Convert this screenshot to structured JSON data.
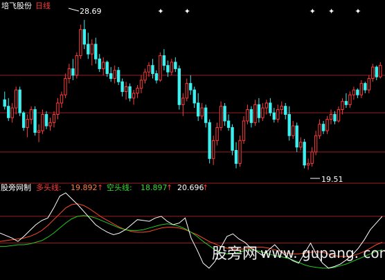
{
  "header": {
    "stock_name": "培飞股份",
    "period": "日线"
  },
  "price_panel": {
    "high_label": "28.69",
    "low_label": "19.51",
    "marker_symbol": "✦"
  },
  "indicator_panel": {
    "name": "股旁网制",
    "items": [
      {
        "label": "多头线:",
        "value": "19.892",
        "arrow": "↑"
      },
      {
        "label": "空头线:",
        "value": "18.897",
        "arrow": "↑"
      },
      {
        "label": "",
        "value": "20.696",
        "arrow": "↑"
      }
    ]
  },
  "watermark": {
    "cn": "股旁网",
    "url": "www. gupang. com"
  },
  "colors": {
    "up": "#ff3b3b",
    "down": "#3cf0f0",
    "grid": "#9b1e1e",
    "white": "#ffffff",
    "long_line": "#ff4a2a",
    "short_line": "#22cc22",
    "value_orange": "#ff8040",
    "value_green": "#33dd33"
  },
  "chart_data": [
    {
      "type": "candlestick",
      "title": "培飞股份 日线",
      "ylim": [
        18.9,
        29.4
      ],
      "high": 28.69,
      "low": 19.51,
      "candles_ohlc": [
        [
          23.8,
          24.3,
          23.2,
          23.4
        ],
        [
          23.4,
          23.9,
          22.5,
          22.7
        ],
        [
          22.7,
          23.6,
          22.4,
          23.3
        ],
        [
          23.3,
          24.6,
          22.9,
          24.4
        ],
        [
          24.4,
          24.6,
          22.8,
          23.0
        ],
        [
          23.0,
          23.1,
          21.9,
          22.1
        ],
        [
          22.1,
          22.9,
          21.5,
          22.6
        ],
        [
          22.6,
          23.4,
          22.3,
          23.2
        ],
        [
          23.2,
          23.4,
          21.6,
          21.8
        ],
        [
          21.8,
          22.3,
          21.2,
          21.9
        ],
        [
          21.9,
          23.2,
          21.7,
          22.9
        ],
        [
          22.9,
          23.1,
          22.0,
          22.2
        ],
        [
          22.2,
          22.7,
          21.9,
          22.4
        ],
        [
          22.4,
          23.1,
          22.1,
          22.9
        ],
        [
          22.9,
          23.9,
          22.6,
          23.6
        ],
        [
          23.6,
          24.3,
          23.3,
          24.1
        ],
        [
          24.1,
          25.4,
          23.9,
          25.1
        ],
        [
          25.1,
          26.0,
          24.8,
          25.7
        ],
        [
          25.7,
          26.3,
          25.0,
          25.3
        ],
        [
          25.3,
          26.7,
          25.1,
          26.5
        ],
        [
          26.5,
          28.4,
          26.3,
          28.1
        ],
        [
          28.1,
          28.69,
          26.9,
          27.2
        ],
        [
          27.2,
          27.9,
          26.3,
          26.6
        ],
        [
          26.6,
          27.5,
          25.9,
          27.2
        ],
        [
          27.2,
          27.6,
          26.0,
          26.3
        ],
        [
          26.3,
          26.6,
          25.5,
          25.7
        ],
        [
          25.7,
          26.4,
          25.3,
          26.1
        ],
        [
          26.1,
          26.2,
          25.2,
          25.4
        ],
        [
          25.4,
          25.8,
          24.9,
          25.1
        ],
        [
          25.1,
          25.9,
          24.8,
          25.6
        ],
        [
          25.6,
          25.8,
          24.7,
          24.9
        ],
        [
          24.9,
          25.1,
          24.0,
          24.3
        ],
        [
          24.3,
          24.9,
          23.8,
          24.6
        ],
        [
          24.6,
          24.8,
          23.7,
          23.9
        ],
        [
          23.9,
          24.4,
          23.5,
          24.2
        ],
        [
          24.2,
          24.7,
          23.9,
          24.5
        ],
        [
          24.5,
          25.3,
          24.2,
          25.0
        ],
        [
          25.0,
          25.7,
          24.8,
          25.5
        ],
        [
          25.5,
          26.1,
          25.2,
          25.9
        ],
        [
          25.9,
          26.3,
          25.1,
          25.4
        ],
        [
          25.4,
          25.6,
          24.8,
          25.0
        ],
        [
          25.0,
          26.7,
          24.9,
          26.5
        ],
        [
          26.5,
          26.9,
          25.6,
          25.9
        ],
        [
          25.9,
          26.2,
          25.2,
          25.5
        ],
        [
          25.5,
          26.3,
          25.3,
          26.1
        ],
        [
          26.1,
          26.4,
          25.5,
          25.7
        ],
        [
          25.7,
          25.9,
          23.2,
          23.5
        ],
        [
          23.5,
          24.2,
          22.8,
          23.9
        ],
        [
          23.9,
          25.1,
          23.7,
          24.8
        ],
        [
          24.8,
          25.3,
          24.1,
          24.4
        ],
        [
          24.4,
          24.6,
          23.3,
          23.6
        ],
        [
          23.6,
          24.2,
          22.5,
          22.8
        ],
        [
          22.8,
          23.6,
          22.6,
          23.3
        ],
        [
          23.3,
          23.5,
          22.1,
          22.4
        ],
        [
          22.4,
          22.6,
          19.9,
          20.2
        ],
        [
          20.2,
          21.6,
          19.8,
          21.3
        ],
        [
          21.3,
          22.4,
          21.0,
          22.1
        ],
        [
          22.1,
          23.7,
          21.9,
          23.4
        ],
        [
          23.4,
          23.6,
          22.2,
          22.5
        ],
        [
          22.5,
          22.9,
          21.9,
          22.1
        ],
        [
          22.1,
          22.3,
          20.4,
          20.7
        ],
        [
          20.7,
          21.2,
          19.6,
          19.9
        ],
        [
          19.9,
          21.6,
          19.7,
          21.3
        ],
        [
          21.3,
          22.8,
          21.1,
          22.5
        ],
        [
          22.5,
          23.5,
          22.3,
          23.2
        ],
        [
          23.2,
          23.4,
          22.1,
          22.4
        ],
        [
          22.4,
          23.8,
          22.2,
          23.5
        ],
        [
          23.5,
          23.9,
          22.4,
          22.7
        ],
        [
          22.7,
          23.6,
          22.5,
          23.3
        ],
        [
          23.3,
          23.8,
          22.9,
          23.6
        ],
        [
          23.6,
          23.9,
          22.8,
          23.0
        ],
        [
          23.0,
          23.3,
          22.4,
          22.6
        ],
        [
          22.6,
          23.5,
          22.4,
          23.2
        ],
        [
          23.2,
          23.7,
          22.9,
          23.4
        ],
        [
          23.4,
          23.6,
          22.6,
          22.9
        ],
        [
          22.9,
          23.4,
          21.3,
          21.6
        ],
        [
          21.6,
          22.5,
          21.4,
          22.2
        ],
        [
          22.2,
          22.4,
          20.6,
          20.9
        ],
        [
          20.9,
          21.5,
          20.7,
          21.2
        ],
        [
          21.2,
          21.4,
          19.6,
          19.8
        ],
        [
          19.8,
          20.2,
          19.51,
          19.9
        ],
        [
          19.9,
          20.9,
          19.7,
          20.6
        ],
        [
          20.6,
          21.9,
          20.4,
          21.6
        ],
        [
          21.6,
          22.6,
          21.4,
          22.3
        ],
        [
          22.3,
          22.5,
          21.7,
          21.9
        ],
        [
          21.9,
          22.8,
          21.7,
          22.6
        ],
        [
          22.6,
          23.2,
          22.3,
          22.9
        ],
        [
          22.9,
          23.1,
          22.3,
          22.5
        ],
        [
          22.5,
          23.4,
          22.4,
          23.2
        ],
        [
          23.2,
          23.9,
          22.9,
          23.7
        ],
        [
          23.7,
          24.2,
          23.3,
          23.5
        ],
        [
          23.5,
          24.3,
          23.3,
          24.1
        ],
        [
          24.1,
          24.6,
          23.8,
          24.4
        ],
        [
          24.4,
          24.5,
          23.9,
          24.1
        ],
        [
          24.1,
          25.0,
          23.9,
          24.8
        ],
        [
          24.8,
          24.9,
          24.2,
          24.4
        ],
        [
          24.4,
          25.3,
          24.2,
          25.1
        ],
        [
          25.1,
          26.0,
          24.9,
          25.8
        ],
        [
          25.8,
          25.9,
          25.0,
          25.2
        ],
        [
          25.2,
          26.1,
          25.1,
          25.9
        ]
      ],
      "grid_levels": [
        25.3,
        23.0,
        20.6
      ]
    },
    {
      "type": "line",
      "title": "股旁网制",
      "ylim": [
        0,
        1
      ],
      "series": [
        {
          "name": "多头线",
          "color": "#ff4a2a",
          "values": [
            0.42,
            0.43,
            0.44,
            0.45,
            0.46,
            0.48,
            0.51,
            0.55,
            0.61,
            0.68,
            0.75,
            0.82,
            0.86,
            0.87,
            0.85,
            0.81,
            0.76,
            0.71,
            0.67,
            0.63,
            0.59,
            0.56,
            0.54,
            0.53,
            0.53,
            0.54,
            0.56,
            0.58,
            0.59,
            0.59,
            0.58,
            0.56,
            0.53,
            0.5,
            0.46,
            0.42,
            0.39,
            0.36,
            0.34,
            0.33,
            0.33,
            0.33,
            0.34,
            0.35,
            0.35,
            0.34,
            0.32,
            0.3,
            0.28,
            0.27,
            0.27,
            0.28,
            0.29,
            0.3,
            0.29,
            0.27,
            0.25,
            0.24,
            0.24,
            0.25,
            0.27,
            0.3,
            0.34,
            0.38,
            0.41
          ]
        },
        {
          "name": "空头线",
          "color": "#22cc22",
          "values": [
            0.36,
            0.36,
            0.37,
            0.38,
            0.38,
            0.39,
            0.41,
            0.43,
            0.47,
            0.52,
            0.58,
            0.64,
            0.69,
            0.72,
            0.73,
            0.72,
            0.7,
            0.67,
            0.64,
            0.61,
            0.58,
            0.56,
            0.55,
            0.55,
            0.56,
            0.58,
            0.6,
            0.62,
            0.63,
            0.62,
            0.6,
            0.57,
            0.53,
            0.48,
            0.42,
            0.37,
            0.32,
            0.29,
            0.27,
            0.27,
            0.29,
            0.31,
            0.32,
            0.31,
            0.29,
            0.27,
            0.25,
            0.24,
            0.22,
            0.2,
            0.17,
            0.14,
            0.12,
            0.11,
            0.1,
            0.1,
            0.11,
            0.13,
            0.15,
            0.18,
            0.21,
            0.24,
            0.27,
            0.3,
            0.32
          ]
        },
        {
          "name": "",
          "color": "#ffffff",
          "values": [
            0.52,
            0.49,
            0.46,
            0.42,
            0.48,
            0.55,
            0.62,
            0.67,
            0.7,
            0.82,
            0.96,
            1.0,
            0.93,
            0.86,
            0.78,
            0.7,
            0.62,
            0.57,
            0.53,
            0.5,
            0.52,
            0.56,
            0.62,
            0.68,
            0.67,
            0.66,
            0.7,
            0.72,
            0.66,
            0.62,
            0.64,
            0.7,
            0.46,
            0.32,
            0.16,
            0.1,
            0.18,
            0.35,
            0.48,
            0.51,
            0.45,
            0.41,
            0.34,
            0.3,
            0.25,
            0.32,
            0.38,
            0.3,
            0.24,
            0.19,
            0.16,
            0.28,
            0.4,
            0.26,
            0.16,
            0.1,
            0.12,
            0.15,
            0.2,
            0.26,
            0.34,
            0.44,
            0.56,
            0.64,
            0.72
          ]
        }
      ]
    }
  ]
}
